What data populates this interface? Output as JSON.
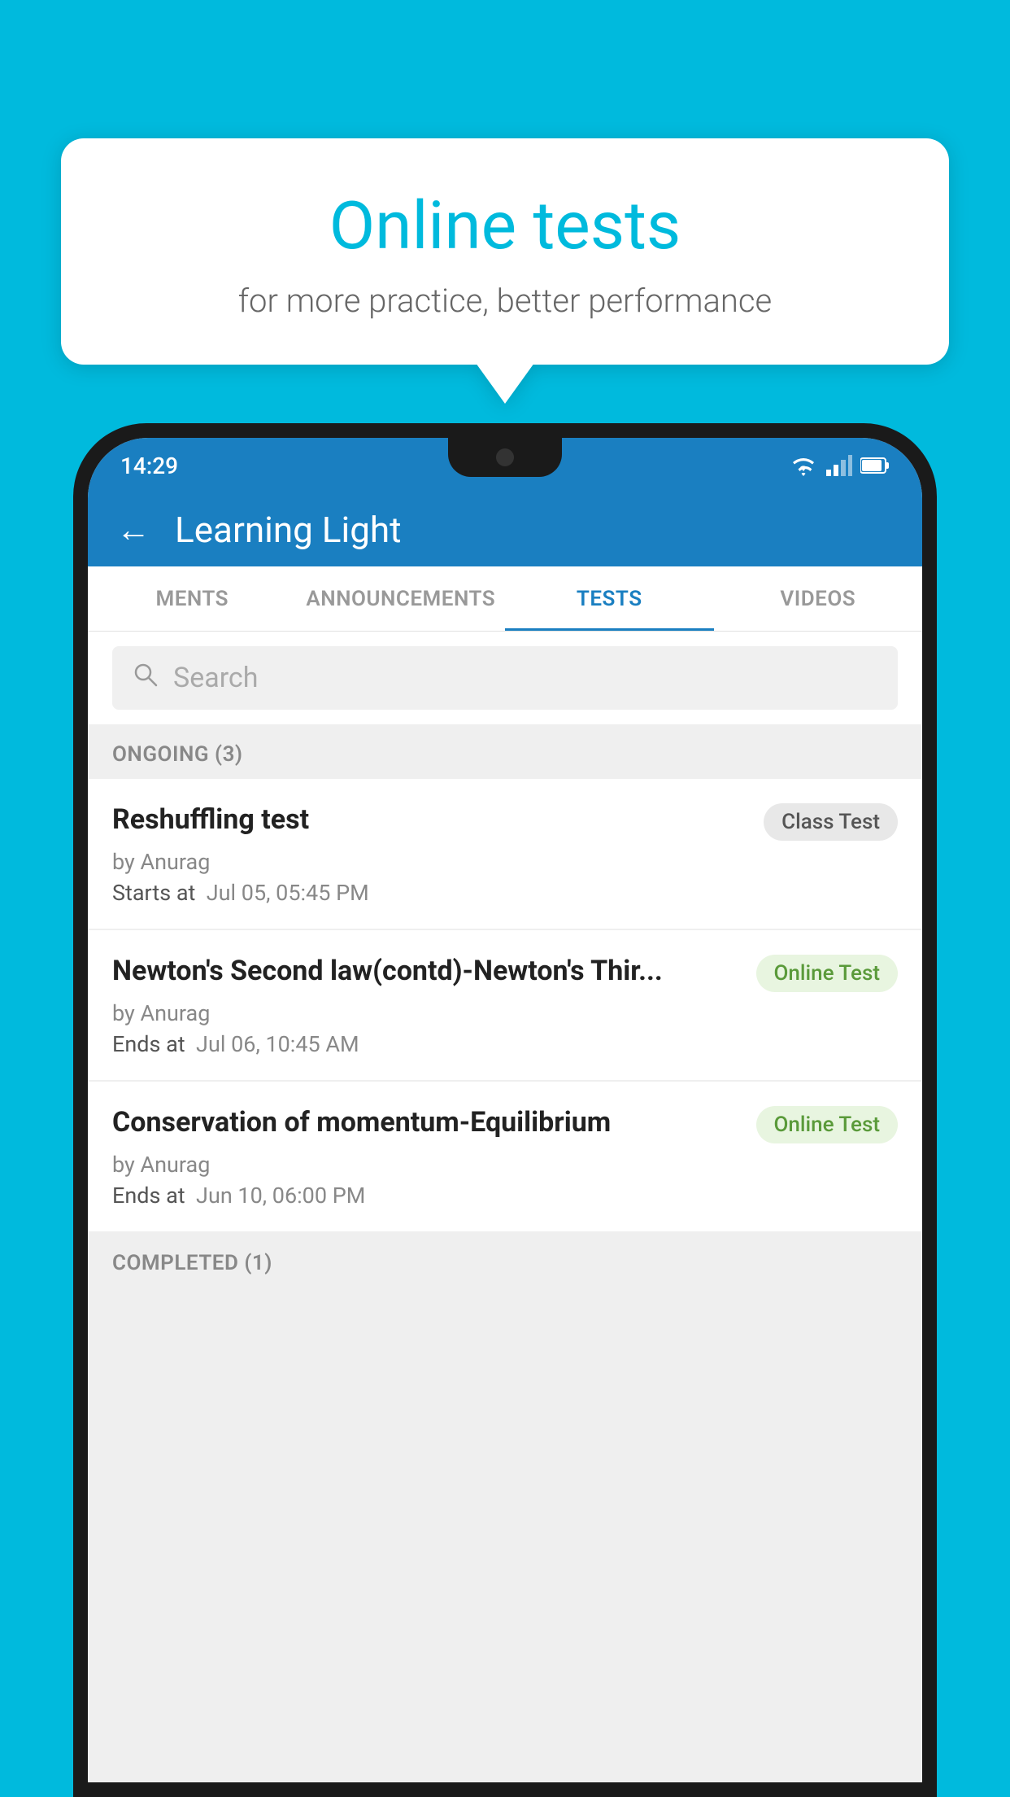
{
  "background_color": "#00BADD",
  "bubble": {
    "title": "Online tests",
    "subtitle": "for more practice, better performance"
  },
  "status_bar": {
    "time": "14:29",
    "icons": [
      "wifi",
      "signal",
      "battery"
    ]
  },
  "app_header": {
    "title": "Learning Light",
    "back_label": "←"
  },
  "tabs": [
    {
      "label": "MENTS",
      "active": false
    },
    {
      "label": "ANNOUNCEMENTS",
      "active": false
    },
    {
      "label": "TESTS",
      "active": true
    },
    {
      "label": "VIDEOS",
      "active": false
    }
  ],
  "search": {
    "placeholder": "Search"
  },
  "ongoing_section": {
    "label": "ONGOING (3)",
    "tests": [
      {
        "title": "Reshuffling test",
        "badge": "Class Test",
        "badge_type": "class",
        "by": "by Anurag",
        "date_label": "Starts at",
        "date": "Jul 05, 05:45 PM"
      },
      {
        "title": "Newton's Second law(contd)-Newton's Thir...",
        "badge": "Online Test",
        "badge_type": "online",
        "by": "by Anurag",
        "date_label": "Ends at",
        "date": "Jul 06, 10:45 AM"
      },
      {
        "title": "Conservation of momentum-Equilibrium",
        "badge": "Online Test",
        "badge_type": "online",
        "by": "by Anurag",
        "date_label": "Ends at",
        "date": "Jun 10, 06:00 PM"
      }
    ]
  },
  "completed_section": {
    "label": "COMPLETED (1)"
  }
}
